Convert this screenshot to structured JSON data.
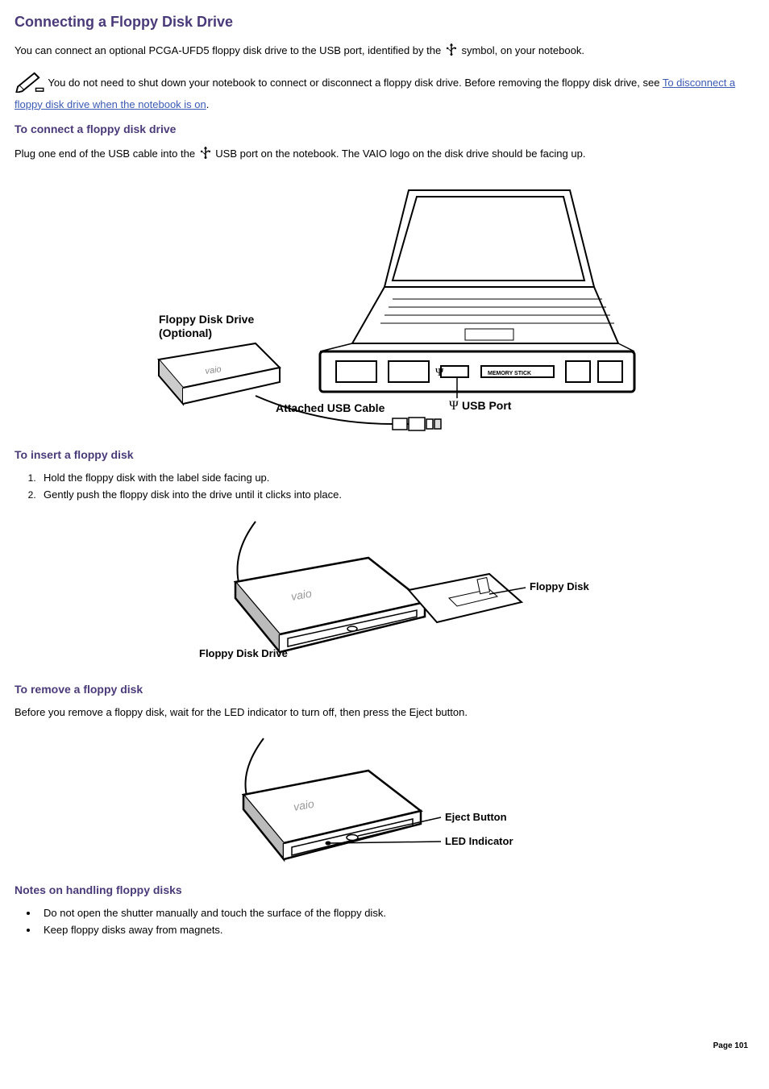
{
  "title": "Connecting a Floppy Disk Drive",
  "intro_before_icon": "You can connect an optional PCGA-UFD5 floppy disk drive to the USB port, identified by the ",
  "intro_after_icon": "symbol, on your notebook.",
  "note_before_link": "You do not need to shut down your notebook to connect or disconnect a floppy disk drive. Before removing the floppy disk drive, see ",
  "note_link_text": "To disconnect a floppy disk drive when the notebook is on",
  "note_after_link": ".",
  "section_connect": {
    "heading": "To connect a floppy disk drive",
    "text_before_icon": "Plug one end of the USB cable into the ",
    "text_after_icon": "USB port on the notebook. The VAIO logo on the disk drive should be facing up."
  },
  "figure1": {
    "label_drive_1": "Floppy Disk Drive",
    "label_drive_2": "(Optional)",
    "label_cable": "Attached USB Cable",
    "label_port": "USB Port",
    "label_stick": "MEMORY STICK"
  },
  "section_insert": {
    "heading": "To insert a floppy disk",
    "steps": [
      "Hold the floppy disk with the label side facing up.",
      "Gently push the floppy disk into the drive until it clicks into place."
    ]
  },
  "figure2": {
    "label_drive": "Floppy Disk Drive",
    "label_disk": "Floppy Disk"
  },
  "section_remove": {
    "heading": "To remove a floppy disk",
    "text": "Before you remove a floppy disk, wait for the LED indicator to turn off, then press the Eject button."
  },
  "figure3": {
    "label_eject": "Eject Button",
    "label_led": "LED Indicator"
  },
  "section_notes": {
    "heading": "Notes on handling floppy disks",
    "items": [
      "Do not open the shutter manually and touch the surface of the floppy disk.",
      "Keep floppy disks away from magnets."
    ]
  },
  "page_number": "Page 101"
}
